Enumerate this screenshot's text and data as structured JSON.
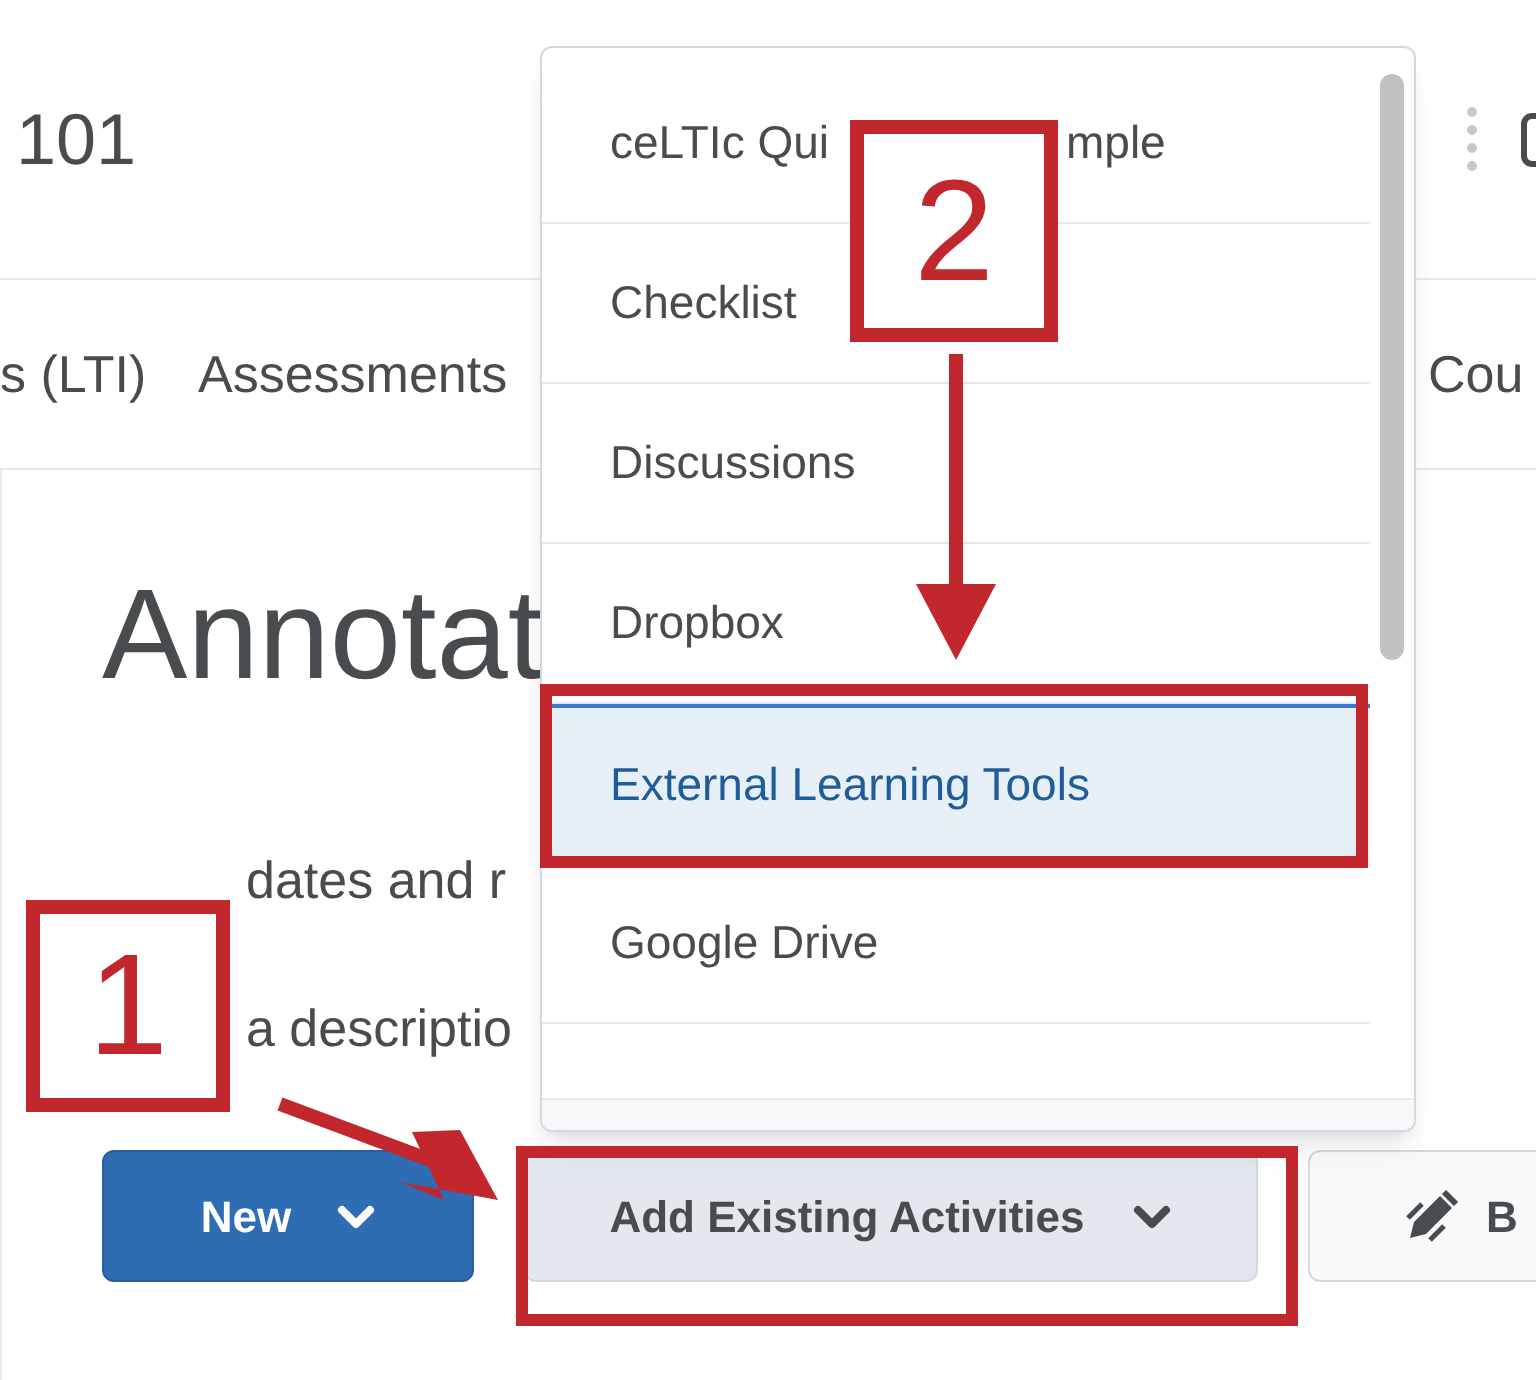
{
  "course_title": "101",
  "nav": [
    {
      "label": "s (LTI)"
    },
    {
      "label": "Assessments"
    },
    {
      "label": "Cou"
    }
  ],
  "page_title": "Annotat",
  "intro_lines": [
    "dates and r",
    "a descriptio"
  ],
  "buttons": [
    {
      "label": "New",
      "kind": "primary"
    },
    {
      "label": "Add Existing Activities",
      "kind": "secondary"
    },
    {
      "label": "B",
      "kind": "outline"
    }
  ],
  "dropdown": {
    "items": [
      {
        "label": "ceLTIc Qui",
        "label_tail": "mple",
        "selected": false
      },
      {
        "label": "Checklist",
        "selected": false
      },
      {
        "label": "Discussions",
        "selected": false
      },
      {
        "label": "Dropbox",
        "selected": false
      },
      {
        "label": "External Learning Tools",
        "selected": true
      },
      {
        "label": "Google Drive",
        "selected": false
      }
    ]
  },
  "annotations": [
    {
      "number": "2"
    },
    {
      "number": "1"
    }
  ]
}
